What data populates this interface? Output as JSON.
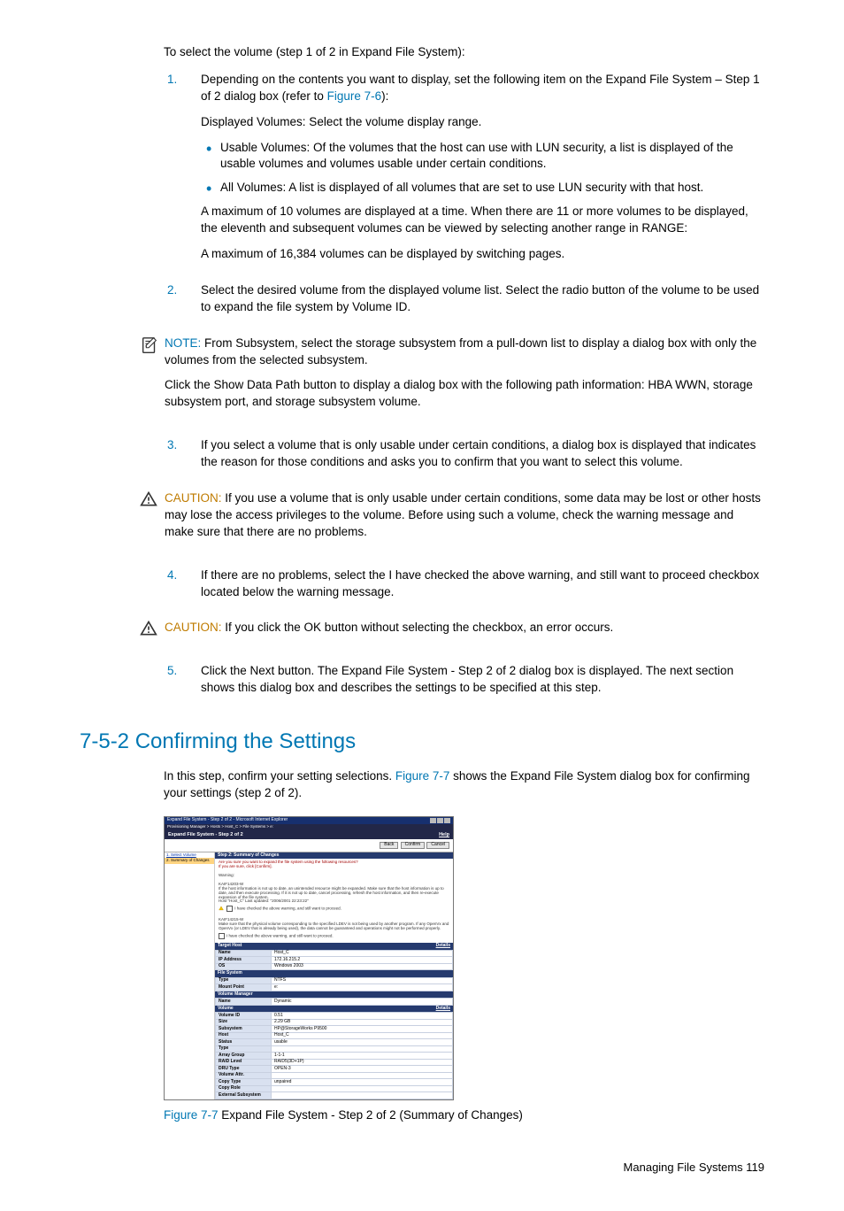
{
  "intro": "To select the volume (step 1 of 2 in Expand File System):",
  "steps": [
    {
      "num": "1.",
      "lead": "Depending on the contents you want to display, set the following item on the Expand File System – Step 1 of 2 dialog box (refer to ",
      "link": "Figure 7-6",
      "lead_tail": "):",
      "p2": "Displayed Volumes: Select the volume display range.",
      "bullets": [
        "Usable Volumes: Of the volumes that the host can use with LUN security, a list is displayed of the usable volumes and volumes usable under certain conditions.",
        "All Volumes: A list is displayed of all volumes that are set to use LUN security with that host."
      ],
      "p3": "A maximum of 10 volumes are displayed at a time. When there are 11 or more volumes to be displayed, the eleventh and subsequent volumes can be viewed by selecting another range in RANGE:",
      "p4": "A maximum of 16,384 volumes can be displayed by switching pages."
    },
    {
      "num": "2.",
      "p": "Select the desired volume from the displayed volume list. Select the radio button of the volume to be used to expand the file system by Volume ID."
    }
  ],
  "note": {
    "label": "NOTE:",
    "body": "  From Subsystem, select the storage subsystem from a pull-down list to display a dialog box with only the volumes from the selected subsystem.",
    "p2": "Click the Show Data Path button to display a dialog box with the following path information: HBA WWN, storage subsystem port, and storage subsystem volume."
  },
  "step3": {
    "num": "3.",
    "p": "If you select a volume that is only usable under certain conditions, a dialog box is displayed that indicates the reason for those conditions and asks you to confirm that you want to select this volume."
  },
  "caution1": {
    "label": "CAUTION:",
    "body": "  If you use a volume that is only usable under certain conditions, some data may be lost or other hosts may lose the access privileges to the volume. Before using such a volume, check the warning message and make sure that there are no problems."
  },
  "step4": {
    "num": "4.",
    "p": "If there are no problems, select the I have checked the above warning, and still want to proceed checkbox located below the warning message."
  },
  "caution2": {
    "label": "CAUTION:",
    "body": "  If you click the OK button without selecting the checkbox, an error occurs."
  },
  "step5": {
    "num": "5.",
    "p": "Click the Next button. The Expand File System - Step 2 of 2 dialog box is displayed. The next section shows this dialog box and describes the settings to be specified at this step."
  },
  "section": "7-5-2 Confirming the Settings",
  "section_intro_a": "In this step, confirm your setting selections. ",
  "section_intro_link": "Figure 7-7",
  "section_intro_b": " shows the Expand File System dialog box for confirming your settings (step 2 of 2).",
  "figcap_link": "Figure 7-7",
  "figcap_text": " Expand File System - Step 2 of 2 (Summary of Changes)",
  "footer": "Managing File Systems  119",
  "ss": {
    "title": "Expand File System - Step 2 of 2 - Microsoft Internet Explorer",
    "breadcrumb": "Provisioning Manager > Hosts > Host_C > File Systems > e:",
    "subhead": "Expand File System - Step 2 of 2",
    "help": "Help",
    "btn_back": "Back",
    "btn_confirm": "Confirm",
    "btn_cancel": "Cancel",
    "side1": "1. Select Volume",
    "side2": "2. Summary of Changes",
    "step2head": "Step 2: Summary of Changes",
    "confirm_prompt": "Are you sure you want to expand the file system using the following resources?",
    "confirm_sub": "If you are sure, click [Confirm].",
    "warn_label": "Warning:",
    "warn1_head": "KAIF14203-W",
    "warn1_body": "If the host information is not up to date, an unintended resource might be expanded. Make sure that the host information is up to date, and then execute processing. If it is not up to date, cancel processing, refresh the host information, and then re-execute expansion of the file system.",
    "warn1_sub": "Host \"Host_C\" Last updated: \"2006/2001 22:23:22\"",
    "warn_check1": "I have checked the above warning, and still want to proceed.",
    "warn2_head": "KAIF14215-W",
    "warn2_body": "Make sure that the physical volume corresponding to the specified LDEV is not being used by another program. If any OpenVx and OpenVx (or LDEV that is already being used), the data cannot be guaranteed and operations might not be performed properly.",
    "warn_check2": "I have checked the above warning, and still want to proceed.",
    "cat_target": "Target Host",
    "details": "Details",
    "name_k": "Name",
    "name_v": "Host_C",
    "ip_k": "IP Address",
    "ip_v": "172.16.215.2",
    "os_k": "OS",
    "os_v": "Windows 2003",
    "cat_fs": "File System",
    "type_k": "Type",
    "type_v": "NTFS",
    "mp_k": "Mount Point",
    "mp_v": "e:",
    "cat_vm": "Volume Manager",
    "vmname_k": "Name",
    "vmname_v": "Dynamic",
    "cat_vol": "Volume",
    "volid_k": "Volume ID",
    "volid_v": "0.51",
    "size_k": "Size",
    "size_v": "2.29 GB",
    "subsys_k": "Subsystem",
    "subsys_v": "HP@StorageWorks P9500",
    "host_k": "Host",
    "host_v": "Host_C",
    "status_k": "Status",
    "status_v": "usable",
    "type2_k": "Type",
    "type2_v": "",
    "arr_k": "Array Group",
    "arr_v": "1-1-1",
    "raid_k": "RAID Level",
    "raid_v": "RAID5(3D+1P)",
    "dist_k": "DRU Type",
    "dist_v": "OPEN-3",
    "attr_k": "Volume Attr.",
    "attr_v": "",
    "ct_k": "Copy Type",
    "ct_v": "unpaired",
    "cr_k": "Copy Role",
    "cr_v": "",
    "es_k": "External Subsystem",
    "es_v": ""
  }
}
